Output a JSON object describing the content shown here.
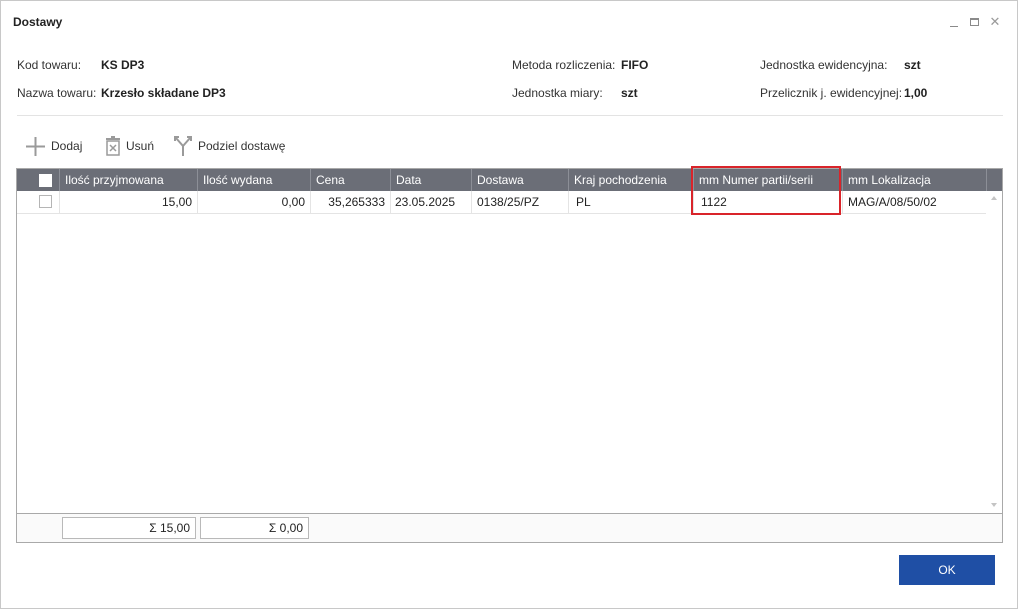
{
  "window": {
    "title": "Dostawy"
  },
  "info": {
    "kod_towaru_label": "Kod towaru:",
    "kod_towaru_value": "KS DP3",
    "nazwa_towaru_label": "Nazwa towaru:",
    "nazwa_towaru_value": "Krzesło składane DP3",
    "metoda_label": "Metoda rozliczenia:",
    "metoda_value": "FIFO",
    "jm_label": "Jednostka miary:",
    "jm_value": "szt",
    "je_label": "Jednostka ewidencyjna:",
    "je_value": "szt",
    "przelicznik_label": "Przelicznik j. ewidencyjnej:",
    "przelicznik_value": "1,00"
  },
  "toolbar": {
    "dodaj_label": "Dodaj",
    "usun_label": "Usuń",
    "podziel_label": "Podziel dostawę"
  },
  "grid": {
    "columns": [
      "Ilość przyjmowana",
      "Ilość wydana",
      "Cena",
      "Data",
      "Dostawa",
      "Kraj pochodzenia",
      "mm Numer partii/serii",
      "mm Lokalizacja"
    ],
    "rows": [
      {
        "ilosc_przyjmowana": "15,00",
        "ilosc_wydana": "0,00",
        "cena": "35,265333",
        "data": "23.05.2025",
        "dostawa": "0138/25/PZ",
        "kraj": "PL",
        "numer_partii": "1122",
        "lokalizacja": "MAG/A/08/50/02"
      }
    ],
    "sum_przyjmowana": "Σ  15,00",
    "sum_wydana": "Σ  0,00"
  },
  "actions": {
    "ok_label": "OK"
  },
  "colors": {
    "header_bg": "#6b6e77",
    "accent": "#1f4fa5",
    "highlight": "#d9242a"
  }
}
